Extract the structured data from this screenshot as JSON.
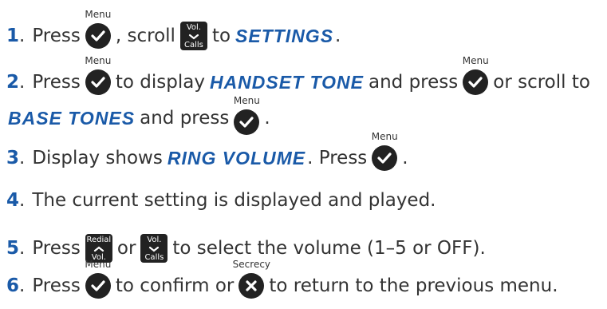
{
  "keys": {
    "menu": "Menu",
    "secrecy": "Secrecy",
    "vol": "Vol.",
    "calls": "Calls",
    "redial": "Redial"
  },
  "steps": [
    {
      "num": "1",
      "dot": ".",
      "t1": "Press",
      "t2": ", scroll",
      "t3": "to",
      "lcd1": "SETTINGS",
      "t4": "."
    },
    {
      "num": "2",
      "dot": ".",
      "t1": "Press",
      "t2": "to display",
      "lcd1": "HANDSET TONE",
      "t3": "and press",
      "t4": "or scroll to"
    },
    {
      "lcd1": "BASE TONES",
      "t1": "and press",
      "t2": "."
    },
    {
      "num": "3",
      "dot": ".",
      "t1": "Display shows",
      "lcd1": "RING VOLUME",
      "t2": ". Press",
      "t3": "."
    },
    {
      "num": "4",
      "dot": ".",
      "t1": "The current setting is displayed and played."
    },
    {
      "num": "5",
      "dot": ".",
      "t1": "Press",
      "t2": "or",
      "t3": "to select the volume (1–5 or OFF)."
    },
    {
      "num": "6",
      "dot": ".",
      "t1": "Press",
      "t2": "to confirm or",
      "t3": "to return to the previous menu."
    }
  ]
}
